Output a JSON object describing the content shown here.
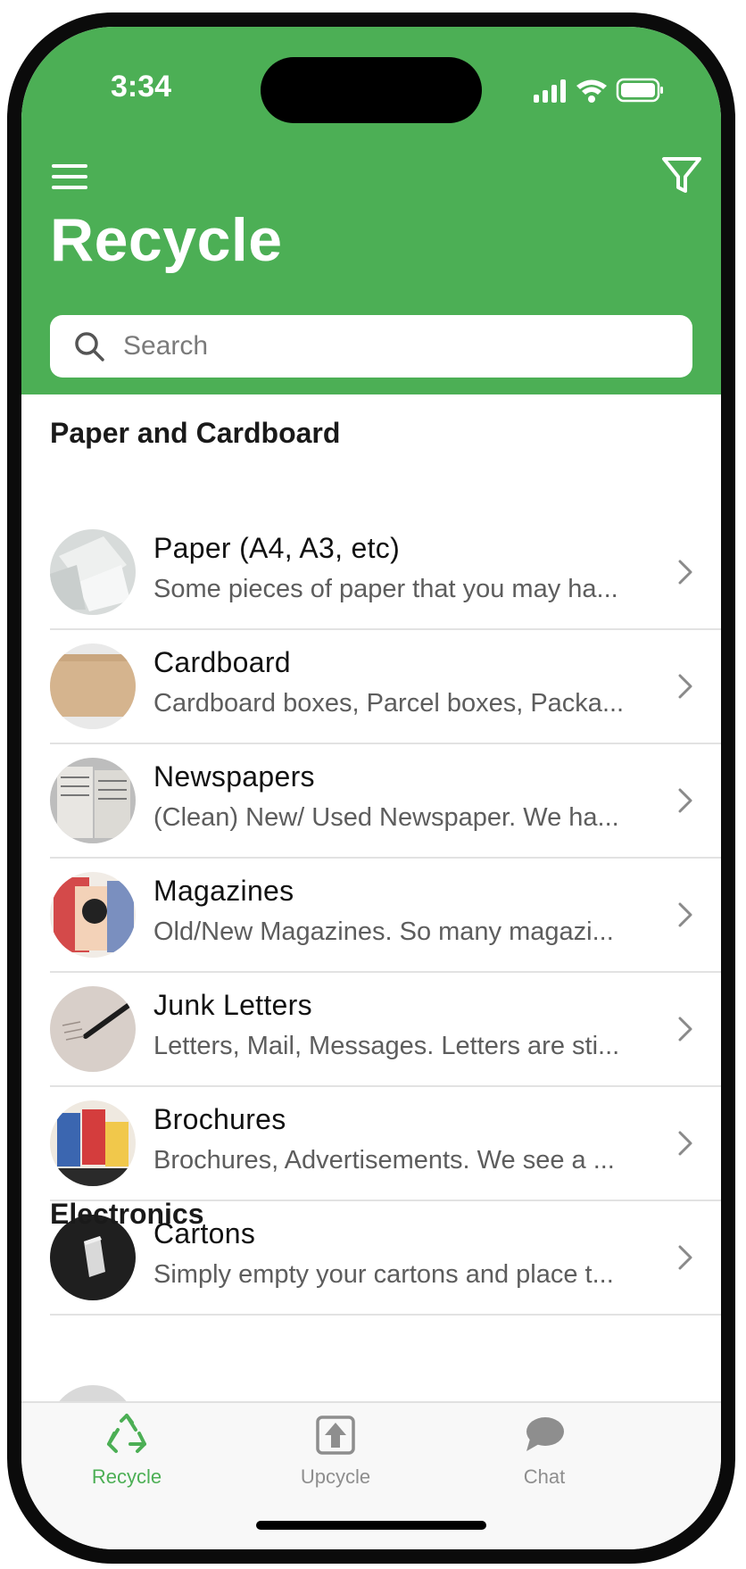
{
  "status_bar": {
    "time": "3:34"
  },
  "header": {
    "title": "Recycle",
    "bg_color": "#4caf55"
  },
  "search": {
    "placeholder": "Search"
  },
  "sections": [
    {
      "title": "Paper and Cardboard",
      "items": [
        {
          "title": "Paper (A4, A3, etc)",
          "description": "Some pieces of paper that you may ha..."
        },
        {
          "title": "Cardboard",
          "description": "Cardboard boxes, Parcel boxes, Packa..."
        },
        {
          "title": "Newspapers",
          "description": "(Clean) New/ Used Newspaper. We ha..."
        },
        {
          "title": "Magazines",
          "description": "Old/New Magazines. So many magazi..."
        },
        {
          "title": "Junk Letters",
          "description": "Letters, Mail, Messages. Letters are sti..."
        },
        {
          "title": "Brochures",
          "description": "Brochures, Advertisements. We see a ..."
        },
        {
          "title": "Cartons",
          "description": "Simply empty your cartons and place t..."
        }
      ]
    },
    {
      "title": "Electronics",
      "items": []
    }
  ],
  "tabbar": {
    "tabs": [
      {
        "label": "Recycle",
        "icon": "recycle-icon",
        "active": true
      },
      {
        "label": "Upcycle",
        "icon": "upcycle-icon",
        "active": false
      },
      {
        "label": "Chat",
        "icon": "chat-icon",
        "active": false
      }
    ],
    "active_color": "#4caf55",
    "inactive_color": "#8e8e8e"
  }
}
